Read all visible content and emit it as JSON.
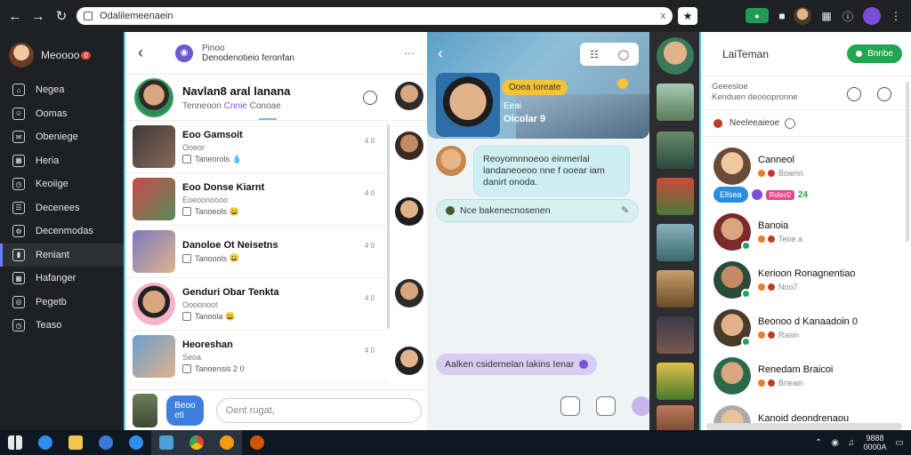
{
  "browser": {
    "url": "Odalilemeenaein",
    "url_clear": "x"
  },
  "sidebar": {
    "user_name": "Meoooo",
    "user_badge": "0",
    "items": [
      {
        "label": "Negea",
        "icon": "home-icon"
      },
      {
        "label": "Oomas",
        "icon": "people-icon"
      },
      {
        "label": "Obeniege",
        "icon": "chat-icon"
      },
      {
        "label": "Heria",
        "icon": "calendar-icon"
      },
      {
        "label": "Keoiige",
        "icon": "clock-icon"
      },
      {
        "label": "Decenees",
        "icon": "list-icon"
      },
      {
        "label": "Decenmodas",
        "icon": "gear-icon"
      },
      {
        "label": "Reniant",
        "icon": "bookmark-icon",
        "active": true
      },
      {
        "label": "Hafanger",
        "icon": "grid-icon"
      },
      {
        "label": "Pegetb",
        "icon": "settings-icon"
      },
      {
        "label": "Teaso",
        "icon": "clock-icon"
      }
    ]
  },
  "conversations": {
    "top_line1": "Pinoo",
    "top_line2": "Denodenotieio feronfan",
    "header_name": "Navlan8 aral lanana",
    "header_sub_a": "Tenneoon",
    "header_sub_b": "Cnnie",
    "header_sub_c": "Conoae",
    "items": [
      {
        "title": "Eoo Gamsoit",
        "sub": "Ooeor",
        "meta": "Tanenrols",
        "emoji": "💧",
        "time": "4 0"
      },
      {
        "title": "Eoo Donse Kiarnt",
        "sub": "Eoeoonoooo",
        "meta": "Tanoeols",
        "emoji": "😀",
        "time": "4 0"
      },
      {
        "title": "Danoloe Ot Neisetns",
        "sub": "",
        "meta": "Tanoools",
        "emoji": "😀",
        "time": "4 0"
      },
      {
        "title": "Genduri Obar Tenkta",
        "sub": "Oooonoot",
        "meta": "Tanoola",
        "emoji": "😀",
        "time": "4 0"
      },
      {
        "title": "Heoreshan",
        "sub": "Seoa",
        "meta": "Tanoensis",
        "emoji": "2 0",
        "time": "4 0"
      }
    ],
    "reply_button": "Beoo eti",
    "input_placeholder": "Oent rugat,"
  },
  "chat": {
    "hero_pill": "Ooea Ioreate",
    "hero_status1": "Eeai",
    "hero_status2": "Oicolar 9",
    "message_in": "Reoyomnnoeoo einmerlal landaneoeoo nne f ooear iam danirt onoda.",
    "tag_text": "Nce bakenecnosenen",
    "message_out": "Aalken csidernelan lakins Ienar"
  },
  "contacts": {
    "title": "LaiTeman",
    "online_button": "Bnnbe",
    "info_line1": "Geeesloe",
    "info_line2": "Kenduen deooopronne",
    "group_label": "Neeleeaieoe",
    "tag_badge": "Ellsea",
    "tag_small": "Rolsc0",
    "tag_count": "24",
    "items": [
      {
        "name": "Canneol",
        "status": "Boienn",
        "online": false
      },
      {
        "name": "Banoia",
        "status": "Teoe a",
        "online": true
      },
      {
        "name": "Kerioon Ronagnentiao",
        "status": "Noo7",
        "online": true
      },
      {
        "name": "Beonoo d Kanaadoin 0",
        "status": "Rasin",
        "online": true
      },
      {
        "name": "Renedam Braicoi",
        "status": "Bneain",
        "online": false
      },
      {
        "name": "Kanoid deondrenaou",
        "status": "",
        "online": false
      }
    ]
  },
  "taskbar": {
    "clock_time": "9888",
    "clock_date": "0000A"
  }
}
